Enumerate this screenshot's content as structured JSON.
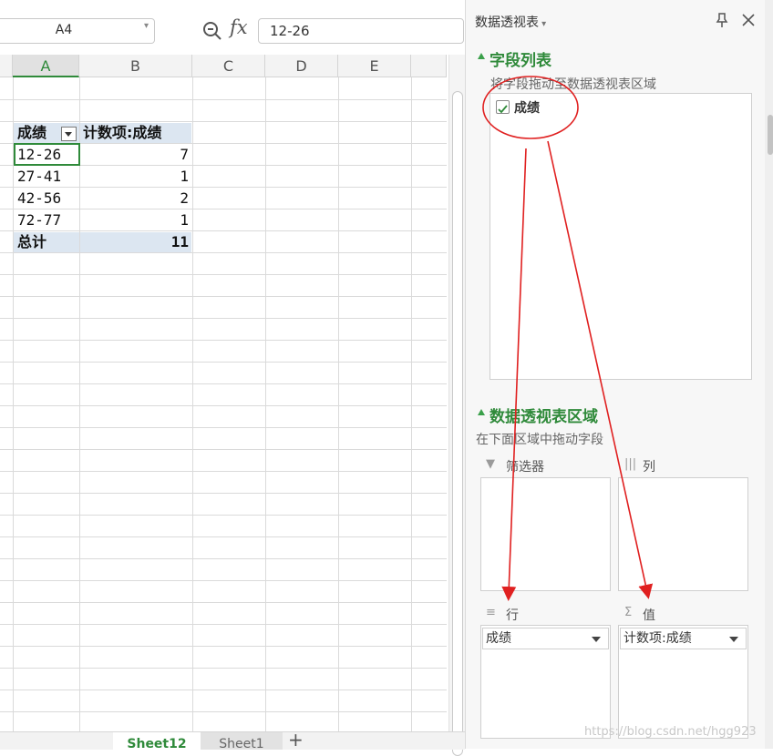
{
  "formula_bar": {
    "name_box": "A4",
    "fx_label": "fx",
    "formula_value": "12-26"
  },
  "grid": {
    "columns": [
      "A",
      "B",
      "C",
      "D",
      "E"
    ],
    "pivot": {
      "header_row_field": "成绩",
      "header_value_field": "计数项:成绩",
      "rows": [
        {
          "label": "12-26",
          "count": "7"
        },
        {
          "label": "27-41",
          "count": "1"
        },
        {
          "label": "42-56",
          "count": "2"
        },
        {
          "label": "72-77",
          "count": "1"
        }
      ],
      "total_label": "总计",
      "total_value": "11"
    }
  },
  "sheet_tabs": {
    "tabs": [
      "Sheet12",
      "Sheet1"
    ],
    "add_label": "+"
  },
  "pivot_panel": {
    "title": "数据透视表",
    "field_list_title": "字段列表",
    "field_list_hint": "将字段拖动至数据透视表区域",
    "fields": [
      {
        "name": "成绩",
        "checked": true
      }
    ],
    "areas_title": "数据透视表区域",
    "areas_hint": "在下面区域中拖动字段",
    "filter_label": "筛选器",
    "column_label": "列",
    "row_label": "行",
    "value_label": "值",
    "row_field": "成绩",
    "value_field": "计数项:成绩"
  },
  "watermark": "https://blog.csdn.net/hgg923",
  "colors": {
    "accent": "#2f8a3a",
    "annotation": "#e02020"
  }
}
